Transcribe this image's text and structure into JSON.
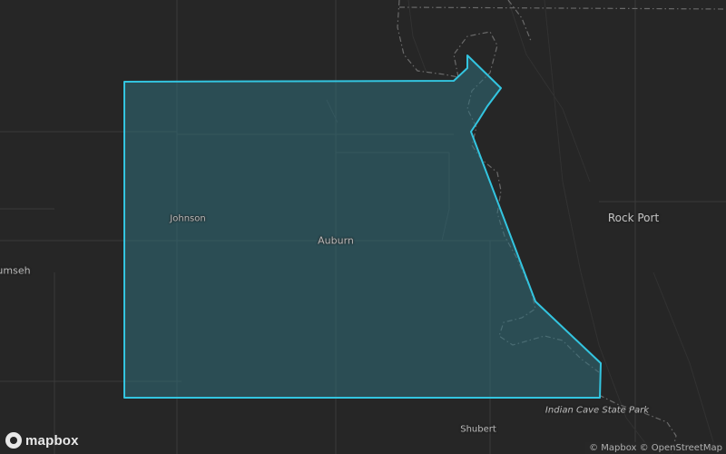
{
  "map": {
    "places": [
      {
        "id": "johnson",
        "label": "Johnson",
        "size": "small"
      },
      {
        "id": "auburn",
        "label": "Auburn",
        "size": "mid"
      },
      {
        "id": "rock-port",
        "label": "Rock Port",
        "size": "town"
      },
      {
        "id": "tecumseh",
        "label": "umseh",
        "size": "mid"
      },
      {
        "id": "shubert",
        "label": "Shubert",
        "size": "small"
      },
      {
        "id": "indian-cave",
        "label": "Indian Cave State Park",
        "size": "park"
      }
    ],
    "highlight_color": "#33c5e0",
    "fill_color": "#2f6e7a",
    "background_color": "#262626"
  },
  "branding": {
    "logo_text": "mapbox",
    "logo_icon": "mapbox-logo-icon"
  },
  "attribution": {
    "mapbox": "© Mapbox",
    "osm": "© OpenStreetMap"
  }
}
